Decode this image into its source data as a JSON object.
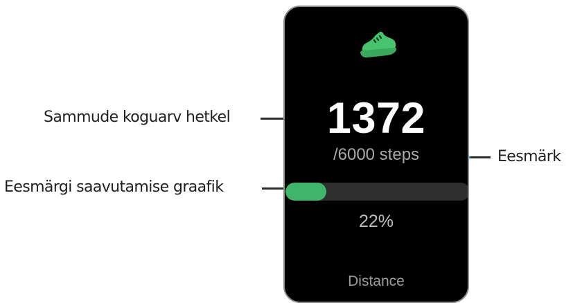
{
  "screen": {
    "steps_current": "1372",
    "steps_goal": "/6000 steps",
    "progress_fraction": 0.22,
    "percent_text": "22%",
    "next_label": "Distance",
    "icon": "shoe-icon"
  },
  "callouts": {
    "current": "Sammude koguarv hetkel",
    "goal": "Eesmärk",
    "graph": "Eesmärgi saavutamise graafik"
  },
  "colors": {
    "screen_bg": "#000000",
    "accent_green": "#3fb56a",
    "track": "#2e2e2e",
    "leader_blue": "#1e88c9"
  }
}
